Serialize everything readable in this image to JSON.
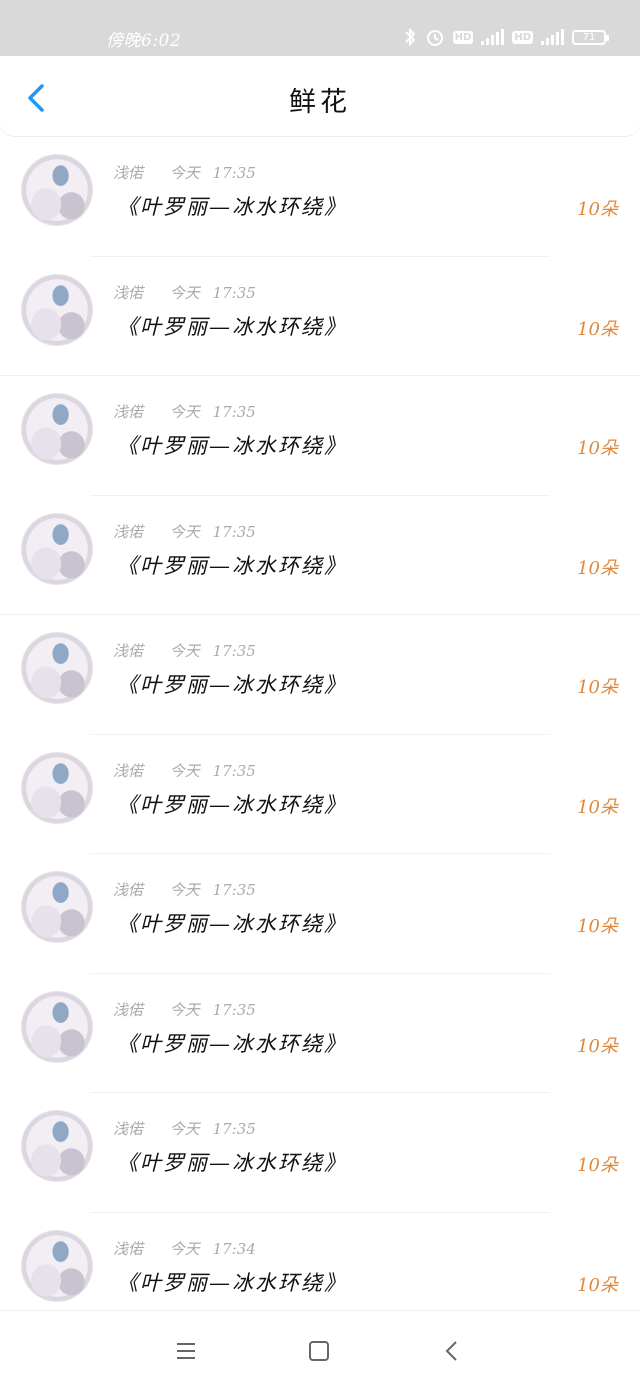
{
  "status_bar": {
    "time": "傍晚6:02",
    "battery": "71"
  },
  "header": {
    "title": "鲜花"
  },
  "list": {
    "items": [
      {
        "name": "浅偌",
        "date": "今天",
        "time": "17:35",
        "gift": "《叶罗丽—冰水环绕》",
        "count": "10朵"
      },
      {
        "name": "浅偌",
        "date": "今天",
        "time": "17:35",
        "gift": "《叶罗丽—冰水环绕》",
        "count": "10朵"
      },
      {
        "name": "浅偌",
        "date": "今天",
        "time": "17:35",
        "gift": "《叶罗丽—冰水环绕》",
        "count": "10朵"
      },
      {
        "name": "浅偌",
        "date": "今天",
        "time": "17:35",
        "gift": "《叶罗丽—冰水环绕》",
        "count": "10朵"
      },
      {
        "name": "浅偌",
        "date": "今天",
        "time": "17:35",
        "gift": "《叶罗丽—冰水环绕》",
        "count": "10朵"
      },
      {
        "name": "浅偌",
        "date": "今天",
        "time": "17:35",
        "gift": "《叶罗丽—冰水环绕》",
        "count": "10朵"
      },
      {
        "name": "浅偌",
        "date": "今天",
        "time": "17:35",
        "gift": "《叶罗丽—冰水环绕》",
        "count": "10朵"
      },
      {
        "name": "浅偌",
        "date": "今天",
        "time": "17:35",
        "gift": "《叶罗丽—冰水环绕》",
        "count": "10朵"
      },
      {
        "name": "浅偌",
        "date": "今天",
        "time": "17:35",
        "gift": "《叶罗丽—冰水环绕》",
        "count": "10朵"
      },
      {
        "name": "浅偌",
        "date": "今天",
        "time": "17:34",
        "gift": "《叶罗丽—冰水环绕》",
        "count": "10朵"
      }
    ]
  },
  "colors": {
    "accent_blue": "#2196f3",
    "count_orange": "#e0883b",
    "meta_gray": "#aaaaaa"
  },
  "icons": [
    "bluetooth-icon",
    "alarm-icon",
    "signal-icon",
    "battery-icon",
    "back-arrow-icon",
    "menu-icon",
    "home-icon",
    "nav-back-icon"
  ]
}
